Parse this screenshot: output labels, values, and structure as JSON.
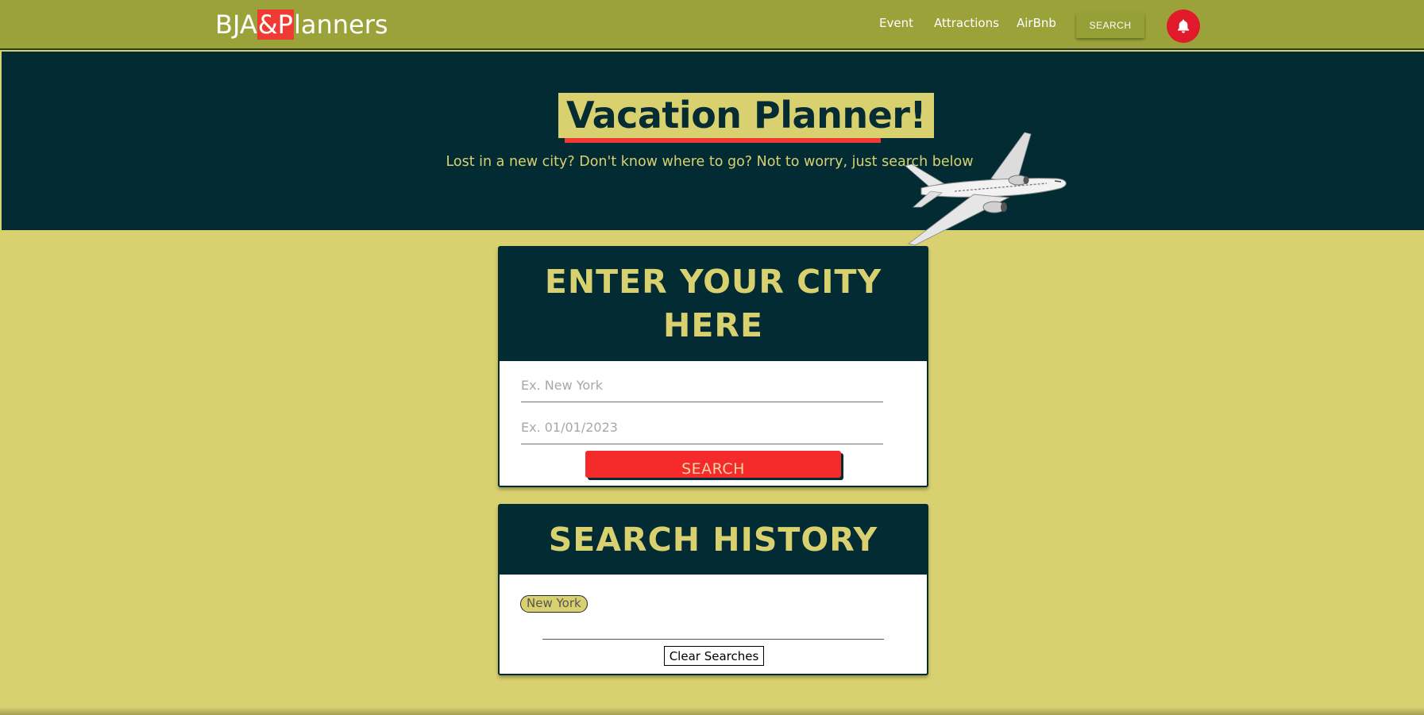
{
  "navbar": {
    "brand_part1": "BJA",
    "brand_highlight": "&P",
    "brand_part2": "lanners",
    "links": [
      "Event",
      "Attractions",
      "AirBnb"
    ],
    "search_label": "SEARCH",
    "icon": "bell-icon"
  },
  "hero": {
    "title": "Vacation Planner!",
    "subtitle": "Lost in a new city? Don't know where to go? Not to worry, just search below",
    "illustration": "airplane"
  },
  "city_form": {
    "heading_line1": "ENTER YOUR CITY",
    "heading_line2": "HERE",
    "city_value": "",
    "city_placeholder": "Ex. New York",
    "date_value": "",
    "date_placeholder": "Ex. 01/01/2023",
    "search_label": "SEARCH"
  },
  "history": {
    "heading": "SEARCH HISTORY",
    "items": [
      "New York"
    ],
    "clear_label": "Clear Searches"
  },
  "colors": {
    "navbar": "#9aa239",
    "hero_bg": "#022b33",
    "accent_yellow": "#d9d16f",
    "accent_red": "#f03a34",
    "bell_red": "#e01a2b"
  }
}
